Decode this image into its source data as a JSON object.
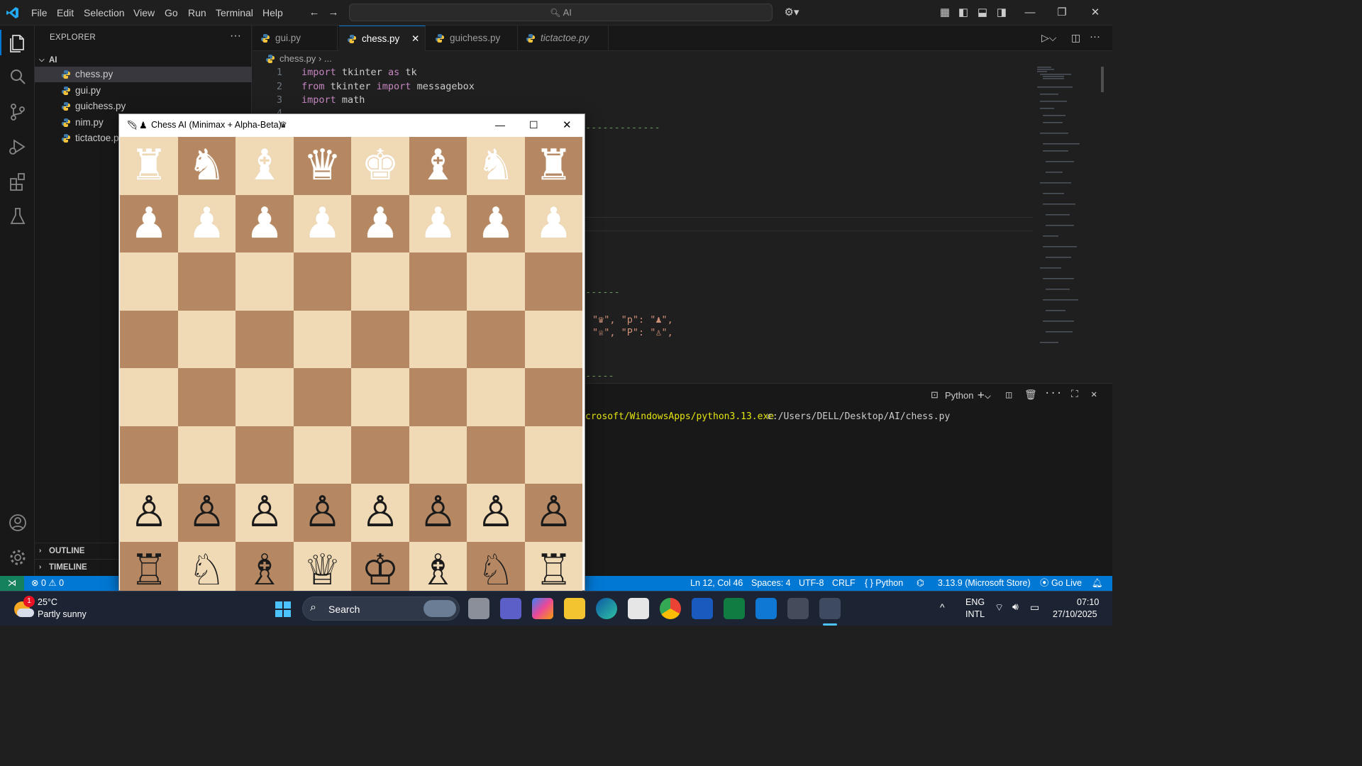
{
  "menu": [
    "File",
    "Edit",
    "Selection",
    "View",
    "Go",
    "Run",
    "Terminal",
    "Help"
  ],
  "command_center": "AI",
  "explorer": {
    "header": "EXPLORER",
    "folder": "AI",
    "files": [
      "chess.py",
      "gui.py",
      "guichess.py",
      "nim.py",
      "tictactoe.py"
    ],
    "outline": "OUTLINE",
    "timeline": "TIMELINE"
  },
  "tabs": [
    "gui.py",
    "chess.py",
    "guichess.py",
    "tictactoe.py"
  ],
  "breadcrumb": {
    "file": "chess.py",
    "rest": "..."
  },
  "code_lines": [
    {
      "n": "1",
      "a": "import",
      "b": " tkinter ",
      "c": "as",
      "d": " tk"
    },
    {
      "n": "2",
      "a": "from",
      "b": " tkinter ",
      "c": "import",
      "d": " messagebox"
    },
    {
      "n": "3",
      "a": "import",
      "b": " math",
      "c": "",
      "d": ""
    }
  ],
  "code_fragments": {
    "line4_num": "4",
    "dash1": "-------------",
    "dash2": "------",
    "dash3": "-----",
    "pieces_row1": "\"♛\", \"p\": \"♟\",",
    "pieces_row2": "\"♕\", \"P\": \"♙\","
  },
  "panel": {
    "terminal_type": "Python",
    "command_path": "crosoft/WindowsApps/python3.13.exe",
    "command_arg": "c:/Users/DELL/Desktop/AI/chess.py"
  },
  "status": {
    "errors": "0",
    "warnings": "0",
    "position": "Ln 12, Col 46",
    "spaces": "Spaces: 4",
    "encoding": "UTF-8",
    "eol": "CRLF",
    "language": "Python",
    "interpreter": "3.13.9 (Microsoft Store)",
    "golive": "Go Live"
  },
  "chess_window": {
    "title": "Chess AI (Minimax + Alpha-Beta)",
    "rows": [
      [
        "♜",
        "♞",
        "♝",
        "♛",
        "♚",
        "♝",
        "♞",
        "♜"
      ],
      [
        "♟",
        "♟",
        "♟",
        "♟",
        "♟",
        "♟",
        "♟",
        "♟"
      ],
      [
        "",
        "",
        "",
        "",
        "",
        "",
        "",
        ""
      ],
      [
        "",
        "",
        "",
        "",
        "",
        "",
        "",
        ""
      ],
      [
        "",
        "",
        "",
        "",
        "",
        "",
        "",
        ""
      ],
      [
        "",
        "",
        "",
        "",
        "",
        "",
        "",
        ""
      ],
      [
        "♙",
        "♙",
        "♙",
        "♙",
        "♙",
        "♙",
        "♙",
        "♙"
      ],
      [
        "♖",
        "♘",
        "♗",
        "♕",
        "♔",
        "♗",
        "♘",
        "♖"
      ]
    ],
    "top_side": "w",
    "bottom_side": "b"
  },
  "taskbar": {
    "weather_temp": "25°C",
    "weather_desc": "Partly sunny",
    "weather_badge": "1",
    "search": "Search",
    "lang1": "ENG",
    "lang2": "INTL",
    "time": "07:10",
    "date": "27/10/2025"
  }
}
